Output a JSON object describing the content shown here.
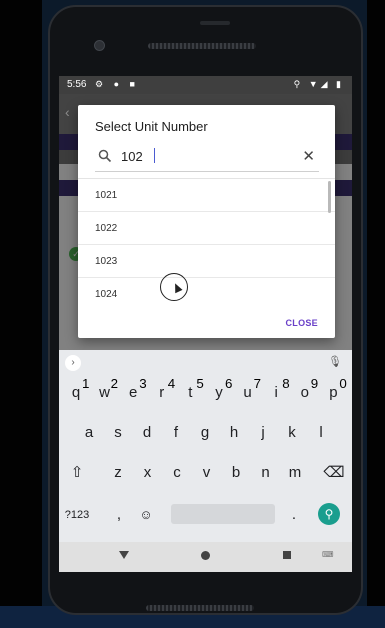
{
  "status_bar": {
    "time": "5:56",
    "left_icons": "⚙ ● ■",
    "right_icons": "⚲ ▼◢ ▮"
  },
  "dialog": {
    "title": "Select Unit Number",
    "search_value": "102",
    "items": [
      "1021",
      "1022",
      "1023",
      "1024"
    ],
    "close_label": "CLOSE"
  },
  "keyboard": {
    "row1": [
      {
        "k": "q",
        "n": "1"
      },
      {
        "k": "w",
        "n": "2"
      },
      {
        "k": "e",
        "n": "3"
      },
      {
        "k": "r",
        "n": "4"
      },
      {
        "k": "t",
        "n": "5"
      },
      {
        "k": "y",
        "n": "6"
      },
      {
        "k": "u",
        "n": "7"
      },
      {
        "k": "i",
        "n": "8"
      },
      {
        "k": "o",
        "n": "9"
      },
      {
        "k": "p",
        "n": "0"
      }
    ],
    "row2": [
      "a",
      "s",
      "d",
      "f",
      "g",
      "h",
      "j",
      "k",
      "l"
    ],
    "row3": [
      "z",
      "x",
      "c",
      "v",
      "b",
      "n",
      "m"
    ],
    "symbols_label": "?123",
    "comma": ",",
    "period": "."
  },
  "colors": {
    "accent": "#6a40c8",
    "enter": "#1a9e8e",
    "app_band": "#3a2f6b"
  }
}
